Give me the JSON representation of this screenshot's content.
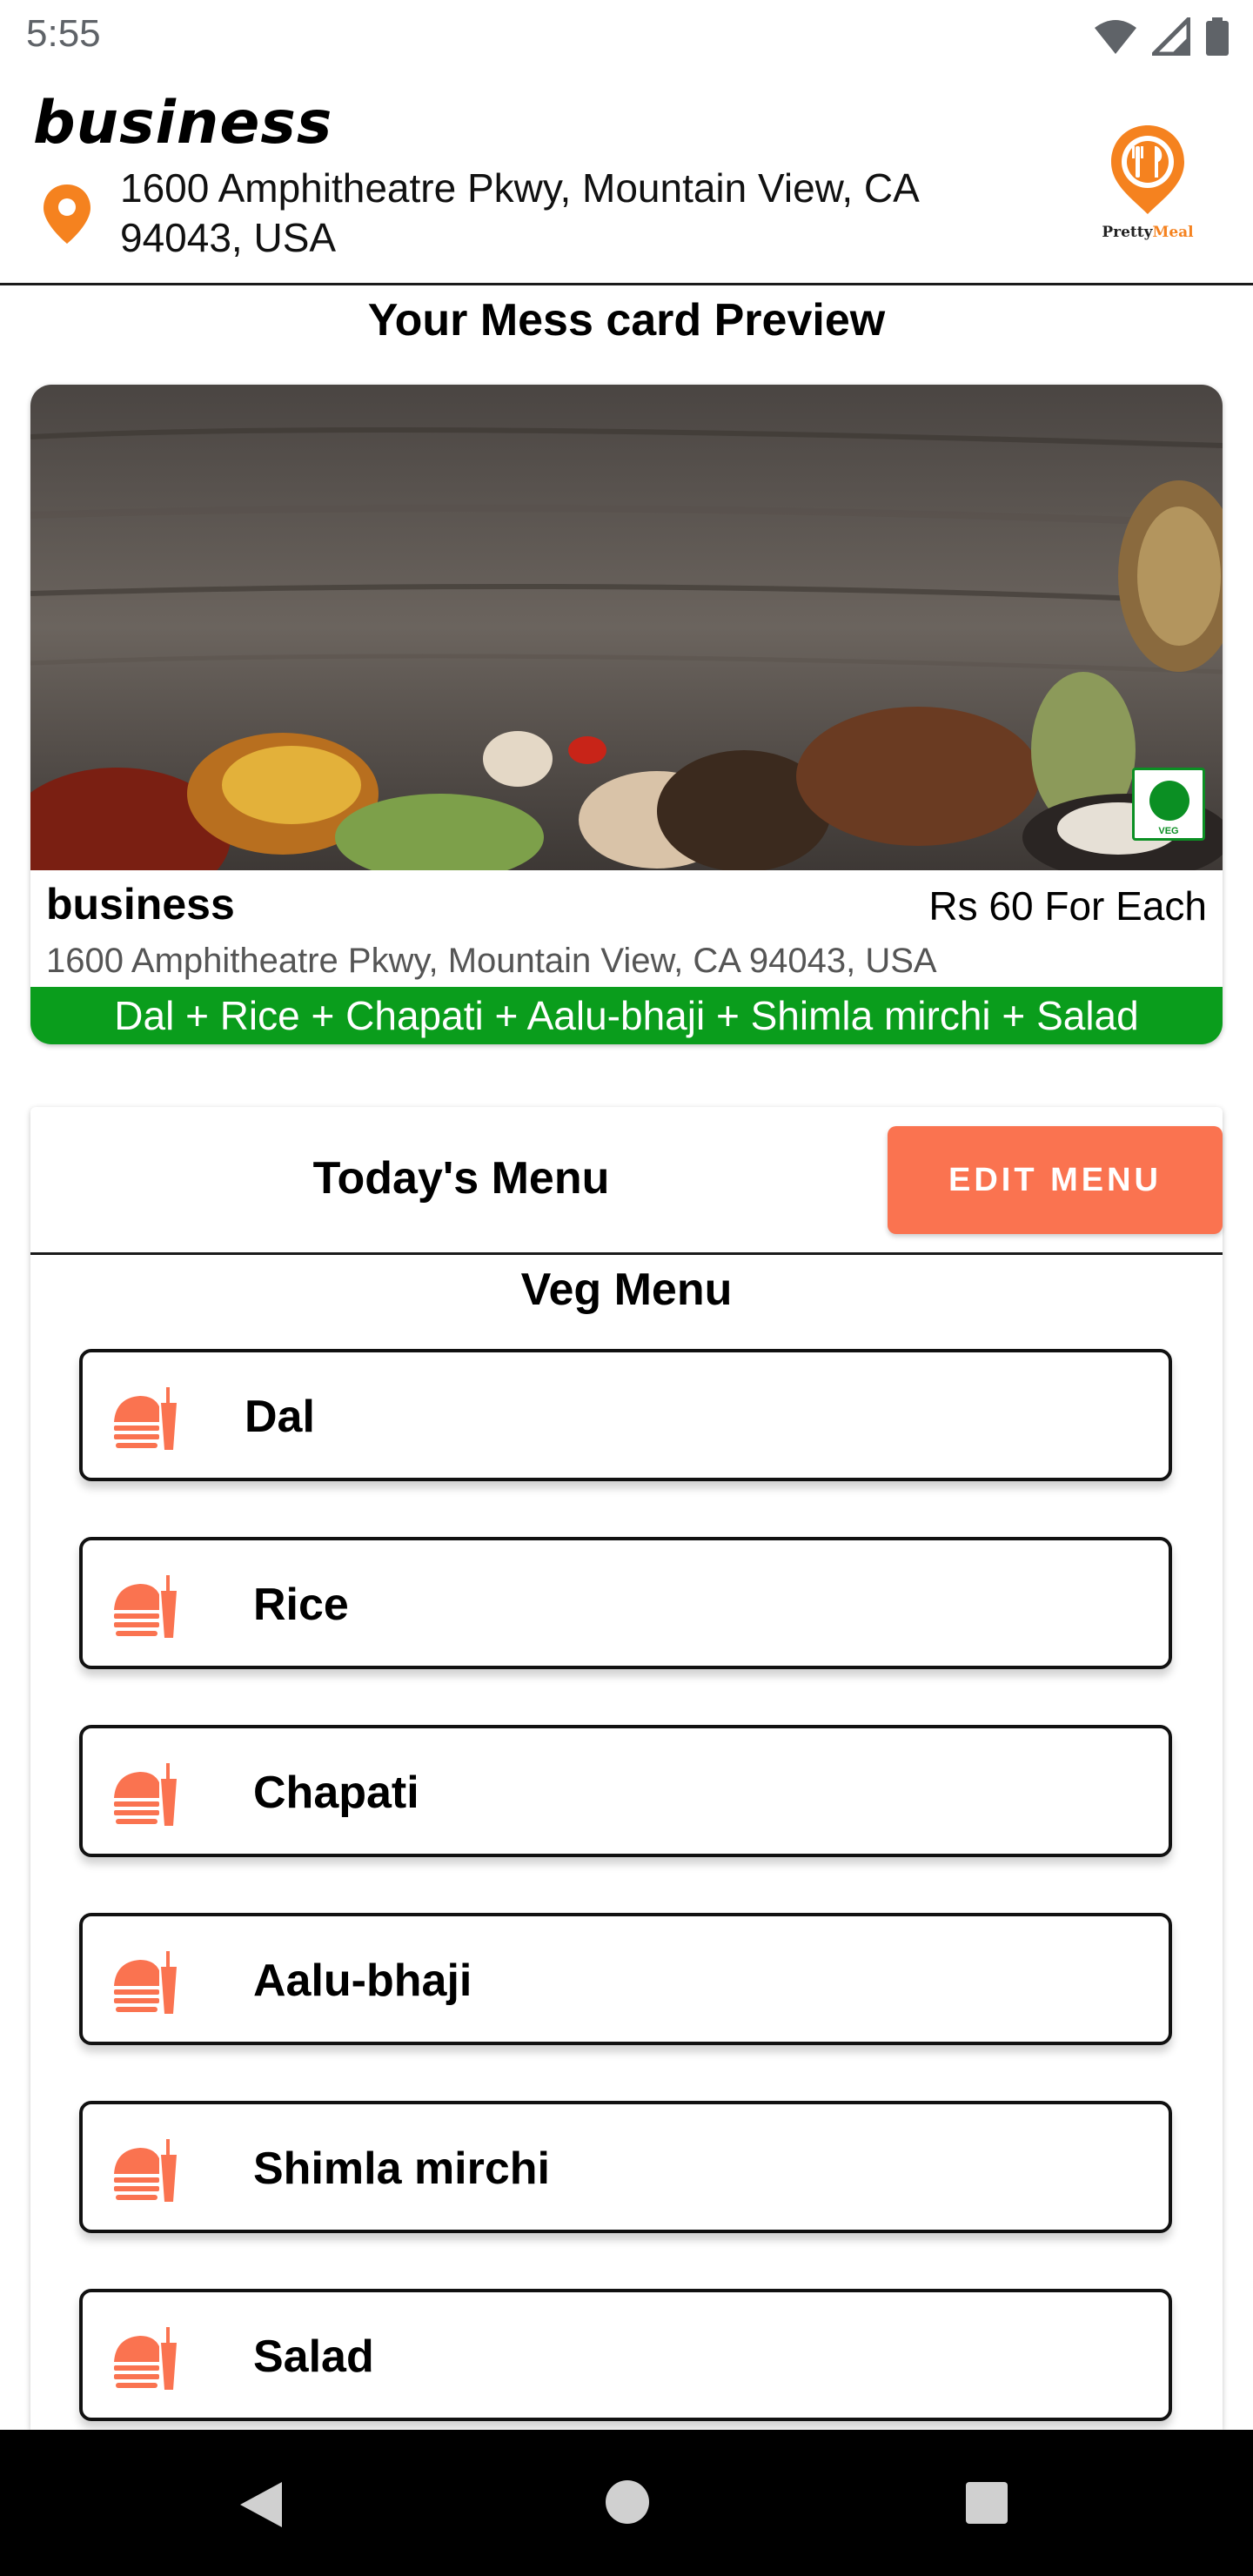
{
  "status_bar": {
    "time": "5:55"
  },
  "header": {
    "business_name": "business",
    "address": "1600 Amphitheatre Pkwy, Mountain View, CA 94043, USA",
    "logo_text_1": "Pretty",
    "logo_text_2": "Meal"
  },
  "preview_title": "Your Mess card Preview",
  "card": {
    "name": "business",
    "price": "Rs 60 For Each",
    "address": "1600 Amphitheatre Pkwy, Mountain View, CA 94043, USA",
    "menu_summary": "Dal + Rice + Chapati + Aalu-bhaji + Shimla mirchi + Salad",
    "veg_badge": "VEG"
  },
  "menu": {
    "title": "Today's Menu",
    "edit_button": "EDIT MENU",
    "section_title": "Veg Menu",
    "items": [
      {
        "label": "Dal"
      },
      {
        "label": "Rice"
      },
      {
        "label": "Chapati"
      },
      {
        "label": "Aalu-bhaji"
      },
      {
        "label": "Shimla mirchi"
      },
      {
        "label": "Salad"
      }
    ]
  },
  "colors": {
    "accent": "#fa7350",
    "logo_orange": "#f5821f",
    "veg_green": "#0a9d1c"
  },
  "icons": [
    "wifi-icon",
    "signal-icon",
    "battery-icon",
    "location-pin-icon",
    "food-icon",
    "back-icon",
    "home-icon",
    "recents-icon"
  ]
}
